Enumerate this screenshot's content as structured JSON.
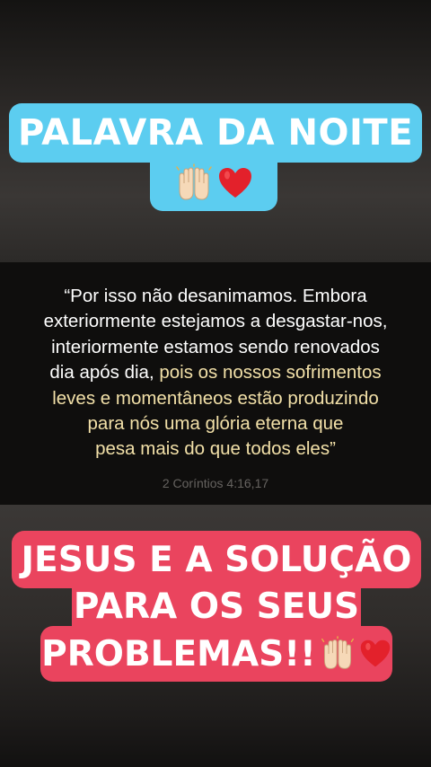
{
  "top_banner": {
    "title": "PALAVRA DA NOITE",
    "icons": [
      "raised-hands-icon",
      "heart-icon"
    ]
  },
  "verse": {
    "line1": "“Por isso não desanimamos. Embora",
    "line2": "exteriormente estejamos a desgastar-nos,",
    "line3": "interiormente estamos sendo renovados",
    "line4_plain": "dia após dia, ",
    "line4_highlight": "pois os nossos sofrimentos",
    "line5": "leves e momentâneos estão produzindo",
    "line6": "para nós uma glória eterna que",
    "line7": "pesa mais do que todos eles”",
    "reference": "2 Coríntios 4:16,17",
    "highlight_color": "#f2e0a8"
  },
  "bottom_banner": {
    "line1": "JESUS E A SOLUÇÃO",
    "line2": "PARA OS SEUS",
    "line3": "PROBLEMAS!!",
    "icons": [
      "raised-hands-icon",
      "heart-icon"
    ]
  },
  "colors": {
    "blue_banner": "#5ccdf0",
    "red_banner": "#ea445e",
    "heart": "#e3212b"
  }
}
